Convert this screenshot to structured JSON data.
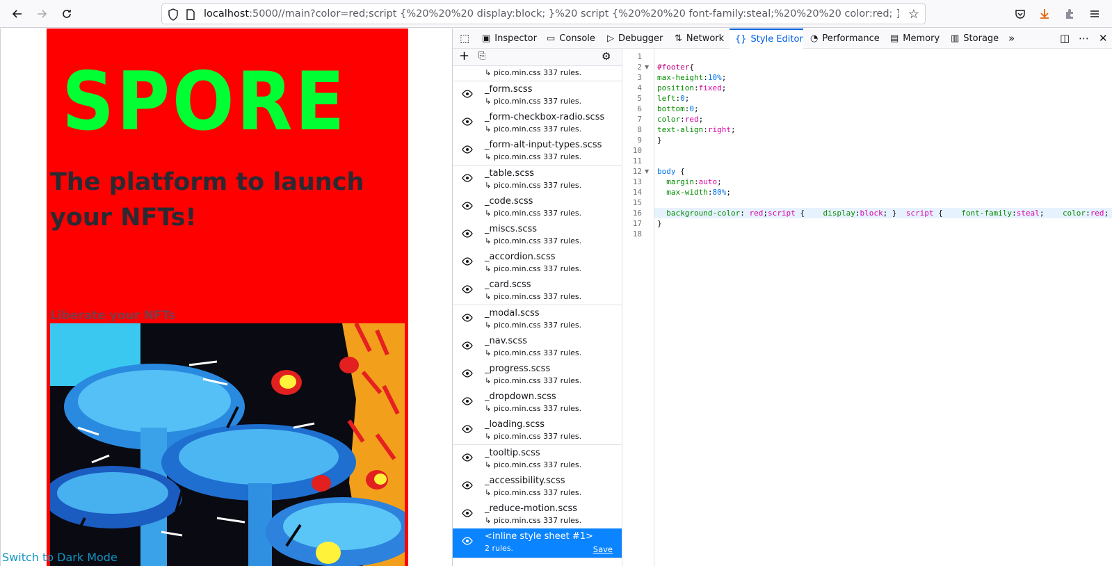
{
  "browser": {
    "url_host": "localhost",
    "url_rest": ":5000//main?color=red;script {%20%20%20 display:block; }%20 script {%20%20%20 font-family:steal;%20%20%20 color:red; }@fon"
  },
  "page": {
    "logo": "SPORE",
    "tagline": "The platform to launch your NFTs!",
    "subheading": "Liberate your NFTs",
    "dark_mode_link": "Switch to Dark Mode",
    "colors": {
      "page_bg": "#ff0000",
      "logo": "#00ff33"
    }
  },
  "devtools": {
    "tabs": [
      {
        "label": "Inspector",
        "icon": "inspector-icon"
      },
      {
        "label": "Console",
        "icon": "console-icon"
      },
      {
        "label": "Debugger",
        "icon": "debugger-icon"
      },
      {
        "label": "Network",
        "icon": "network-icon"
      },
      {
        "label": "Style Editor",
        "icon": "style-editor-icon",
        "active": true
      },
      {
        "label": "Performance",
        "icon": "performance-icon"
      },
      {
        "label": "Memory",
        "icon": "memory-icon"
      },
      {
        "label": "Storage",
        "icon": "storage-icon"
      }
    ],
    "sheets": [
      {
        "name": "_form.scss",
        "meta": "↳ pico.min.css 337 rules."
      },
      {
        "name": "_form-checkbox-radio.scss",
        "meta": "↳ pico.min.css 337 rules."
      },
      {
        "name": "_form-alt-input-types.scss",
        "meta": "↳ pico.min.css 337 rules."
      },
      {
        "name": "_table.scss",
        "meta": "↳ pico.min.css 337 rules."
      },
      {
        "name": "_code.scss",
        "meta": "↳ pico.min.css 337 rules."
      },
      {
        "name": "_miscs.scss",
        "meta": "↳ pico.min.css 337 rules."
      },
      {
        "name": "_accordion.scss",
        "meta": "↳ pico.min.css 337 rules."
      },
      {
        "name": "_card.scss",
        "meta": "↳ pico.min.css 337 rules."
      },
      {
        "name": "_modal.scss",
        "meta": "↳ pico.min.css 337 rules."
      },
      {
        "name": "_nav.scss",
        "meta": "↳ pico.min.css 337 rules."
      },
      {
        "name": "_progress.scss",
        "meta": "↳ pico.min.css 337 rules."
      },
      {
        "name": "_dropdown.scss",
        "meta": "↳ pico.min.css 337 rules."
      },
      {
        "name": "_loading.scss",
        "meta": "↳ pico.min.css 337 rules."
      },
      {
        "name": "_tooltip.scss",
        "meta": "↳ pico.min.css 337 rules."
      },
      {
        "name": "_accessibility.scss",
        "meta": "↳ pico.min.css 337 rules."
      },
      {
        "name": "_reduce-motion.scss",
        "meta": "↳ pico.min.css 337 rules."
      }
    ],
    "partial_sheet_meta": "↳ pico.min.css 337 rules.",
    "selected_sheet": {
      "name": "<inline style sheet #1>",
      "meta": "2 rules.",
      "save_label": "Save"
    },
    "code": {
      "line_numbers": [
        "1",
        "2",
        "3",
        "4",
        "5",
        "6",
        "7",
        "8",
        "9",
        "10",
        "11",
        "12",
        "13",
        "14",
        "15",
        "16",
        "17",
        "18"
      ],
      "l2_sel": "#footer",
      "l2_brace": "{",
      "l3_prop": "max-height",
      "l3_val": "10%",
      "l4_prop": "position",
      "l4_val": "fixed",
      "l5_prop": "left",
      "l5_val": "0",
      "l6_prop": "bottom",
      "l6_val": "0",
      "l7_prop": "color",
      "l7_val": "red",
      "l8_prop": "text-align",
      "l8_val": "right",
      "l9": "}",
      "l12_sel": "body",
      "l12_brace": " {",
      "l13_prop": "margin",
      "l13_val": "auto",
      "l14_prop": "max-width",
      "l14_val": "80%",
      "l16_prop": "background-color",
      "l16_val": "red",
      "l16_a": "script",
      "l16_b": " {    ",
      "l16_c": "display",
      "l16_d": "block",
      "l16_e": "; }  ",
      "l16_f": "script",
      "l16_g": " {    ",
      "l16_h": "font-family",
      "l16_i": "steal",
      "l16_j": ";    ",
      "l16_k": "color",
      "l16_l": "red",
      "l16_m": ";",
      "l17": "}"
    }
  }
}
